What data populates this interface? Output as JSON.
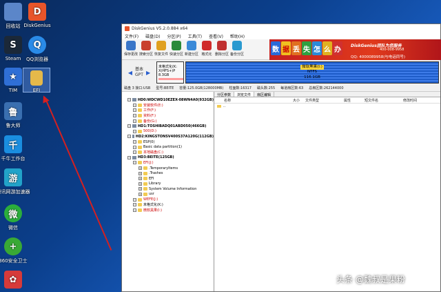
{
  "desktop": {
    "icons": [
      {
        "label": "回收站",
        "color": "#5b86c9",
        "glyph": "🗑"
      },
      {
        "label": "DiskGenius",
        "color": "#e8552a",
        "glyph": "D"
      },
      {
        "label": "Steam",
        "color": "#1b2838",
        "glyph": "S"
      },
      {
        "label": "QQ浏览器",
        "color": "#2a8be8",
        "glyph": "Q"
      },
      {
        "label": "TIM",
        "color": "#2f6fd6",
        "glyph": "★"
      },
      {
        "label": "EFI",
        "color": "#e5b94a",
        "glyph": "▮"
      },
      {
        "label": "鲁大师",
        "color": "#3a6fb0",
        "glyph": "鲁"
      },
      {
        "label": "千牛工作台",
        "color": "#1a8ee0",
        "glyph": "千"
      },
      {
        "label": "腾讯网游加速器",
        "color": "#22a3c9",
        "glyph": "游"
      },
      {
        "label": "微信",
        "color": "#2bae3c",
        "glyph": "微"
      },
      {
        "label": "360安全卫士",
        "color": "#39a935",
        "glyph": "+"
      },
      {
        "label": "",
        "color": "#d63a3a",
        "glyph": "✿"
      }
    ]
  },
  "window": {
    "title": "DiskGenius V5.2.0.884 x64",
    "menu": [
      "文件(F)",
      "磁盘(D)",
      "分区(P)",
      "工具(T)",
      "查看(V)",
      "帮助(H)"
    ],
    "toolbar": [
      {
        "label": "保存更改",
        "color": "#3a76c8"
      },
      {
        "label": "搜索分区",
        "color": "#c9402d"
      },
      {
        "label": "恢复文件",
        "color": "#e0a020"
      },
      {
        "label": "快速分区",
        "color": "#2a8a3a"
      },
      {
        "label": "新建分区",
        "color": "#3a8ad8"
      },
      {
        "label": "格式化",
        "color": "#d02a2a"
      },
      {
        "label": "删除分区",
        "color": "#c03030"
      },
      {
        "label": "备份分区",
        "color": "#2a9ad0"
      }
    ],
    "banner": {
      "chars": [
        "数",
        "据",
        "丢",
        "失",
        "怎",
        "么",
        "办"
      ],
      "brand": "DiskGenius团队为您服务",
      "phone": "400-008-9958",
      "qq": "QQ: 4000089958(与电话同号)"
    },
    "diskmap": {
      "nav_top": "基本",
      "nav_bottom": "GPT",
      "part1_lines": [
        "未格式化(K:",
        "X(HFS+)P",
        "8.3GB"
      ],
      "part2_title": "微软黑果(I:)",
      "part2_fs": "NTFS",
      "part2_size": "116.1GB"
    },
    "infobar": [
      "磁盘 3 接口:USB",
      "型号:BEITE",
      "容量:125.0GB(128000MB)",
      "柱面数:16317",
      "磁头数:255",
      "每道扇区数:63",
      "总扇区数:262144000"
    ],
    "tree": [
      {
        "text": "HD0:WDCWD10EZEX-08WN4A0(932GB)",
        "level": 0,
        "type": "disk",
        "color": "#000"
      },
      {
        "text": "安装软件(E:)",
        "level": 1,
        "type": "part",
        "color": "#c00"
      },
      {
        "text": "工作(F:)",
        "level": 1,
        "type": "part",
        "color": "#c00"
      },
      {
        "text": "资料(F:)",
        "level": 1,
        "type": "part",
        "color": "#c00"
      },
      {
        "text": "备份(G:)",
        "level": 1,
        "type": "part",
        "color": "#c00"
      },
      {
        "text": "HD1:TOSHIBADQ01ABD050(466GB)",
        "level": 0,
        "type": "disk",
        "color": "#000"
      },
      {
        "text": "500(D:)",
        "level": 1,
        "type": "part",
        "color": "#c00"
      },
      {
        "text": "HD2:KINGSTONSV400S37A120G(112GB)",
        "level": 0,
        "type": "disk",
        "color": "#000"
      },
      {
        "text": "ESP(0)",
        "level": 1,
        "type": "part",
        "color": "#000"
      },
      {
        "text": "Basic data partition(1)",
        "level": 1,
        "type": "part",
        "color": "#000"
      },
      {
        "text": "本地磁盘(C:)",
        "level": 1,
        "type": "part",
        "color": "#c00"
      },
      {
        "text": "HD3:BEITE(125GB)",
        "level": 0,
        "type": "disk",
        "color": "#000"
      },
      {
        "text": "EFI(J:)",
        "level": 1,
        "type": "part",
        "color": "#c00"
      },
      {
        "text": ".TemporaryItems",
        "level": 2,
        "type": "folder",
        "color": "#000"
      },
      {
        "text": ".Trashes",
        "level": 2,
        "type": "folder",
        "color": "#000"
      },
      {
        "text": "EFI",
        "level": 2,
        "type": "folder",
        "color": "#000"
      },
      {
        "text": "Library",
        "level": 2,
        "type": "folder",
        "color": "#000"
      },
      {
        "text": "System Volume Information",
        "level": 2,
        "type": "folder",
        "color": "#000"
      },
      {
        "text": "usr",
        "level": 2,
        "type": "folder",
        "color": "#000"
      },
      {
        "text": "WEFE(J:)",
        "level": 1,
        "type": "part",
        "color": "#c00"
      },
      {
        "text": "未格式化(K:)",
        "level": 1,
        "type": "part",
        "color": "#000"
      },
      {
        "text": "微软黑果(I:)",
        "level": 1,
        "type": "part",
        "color": "#c00"
      }
    ],
    "tabs": [
      "分区参数",
      "浏览文件",
      "扇区编辑"
    ],
    "columns": [
      "名称",
      "大小",
      "文件类型",
      "属性",
      "短文件名",
      "修改时间"
    ],
    "file_rows": [
      ".."
    ]
  },
  "watermark": "头条 @魏叔是果粉",
  "watermark_small": "魏叔是果粉"
}
